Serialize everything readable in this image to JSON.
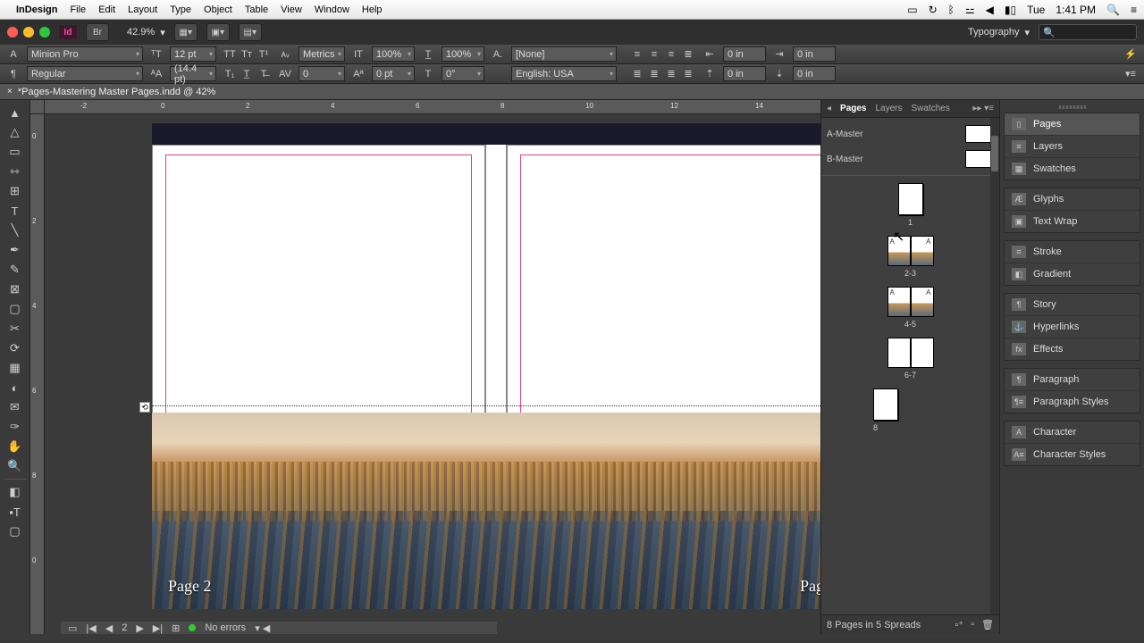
{
  "menubar": {
    "app_name": "InDesign",
    "items": [
      "File",
      "Edit",
      "Layout",
      "Type",
      "Object",
      "Table",
      "View",
      "Window",
      "Help"
    ],
    "right": {
      "day": "Tue",
      "time": "1:41 PM"
    }
  },
  "appbar": {
    "zoom": "42.9%",
    "workspace": "Typography"
  },
  "control_row1": {
    "font": "Minion Pro",
    "size": "12 pt",
    "kerning": "Metrics",
    "hscale": "100%",
    "vscale": "100%",
    "char_style": "[None]",
    "indent_left": "0 in",
    "indent_right": "0 in"
  },
  "control_row2": {
    "style": "Regular",
    "leading": "(14.4 pt)",
    "tracking": "0",
    "baseline_shift": "0 pt",
    "skew": "0°",
    "language": "English: USA",
    "space_before": "0 in",
    "space_after": "0 in"
  },
  "doctab": {
    "title": "*Pages-Mastering Master Pages.indd @ 42%"
  },
  "ruler": {
    "h": [
      "-2",
      "0",
      "2",
      "4",
      "6",
      "8",
      "10",
      "12",
      "14"
    ],
    "v": [
      "0",
      "2",
      "4",
      "6",
      "8",
      "0"
    ]
  },
  "spread": {
    "page_left_label": "Page 2",
    "page_right_label": "Page"
  },
  "pages_panel": {
    "tabs": [
      "Pages",
      "Layers",
      "Swatches"
    ],
    "active_tab": 0,
    "masters": [
      "A-Master",
      "B-Master"
    ],
    "pages": [
      {
        "label": "1",
        "type": "single"
      },
      {
        "label": "2-3",
        "type": "spread",
        "letters": [
          "A",
          "A"
        ],
        "img": true
      },
      {
        "label": "4-5",
        "type": "spread",
        "letters": [
          "A",
          "A"
        ],
        "img": true
      },
      {
        "label": "6-7",
        "type": "spread",
        "letters": [
          "",
          ""
        ],
        "img": false
      },
      {
        "label": "8",
        "type": "single"
      }
    ],
    "footer": "8 Pages in 5 Spreads"
  },
  "right_dock": [
    [
      "Pages",
      "Layers",
      "Swatches"
    ],
    [
      "Glyphs",
      "Text Wrap"
    ],
    [
      "Stroke",
      "Gradient"
    ],
    [
      "Story",
      "Hyperlinks",
      "Effects"
    ],
    [
      "Paragraph",
      "Paragraph Styles"
    ],
    [
      "Character",
      "Character Styles"
    ]
  ],
  "right_dock_active": "Pages",
  "statusbar": {
    "page": "2",
    "errors": "No errors"
  }
}
